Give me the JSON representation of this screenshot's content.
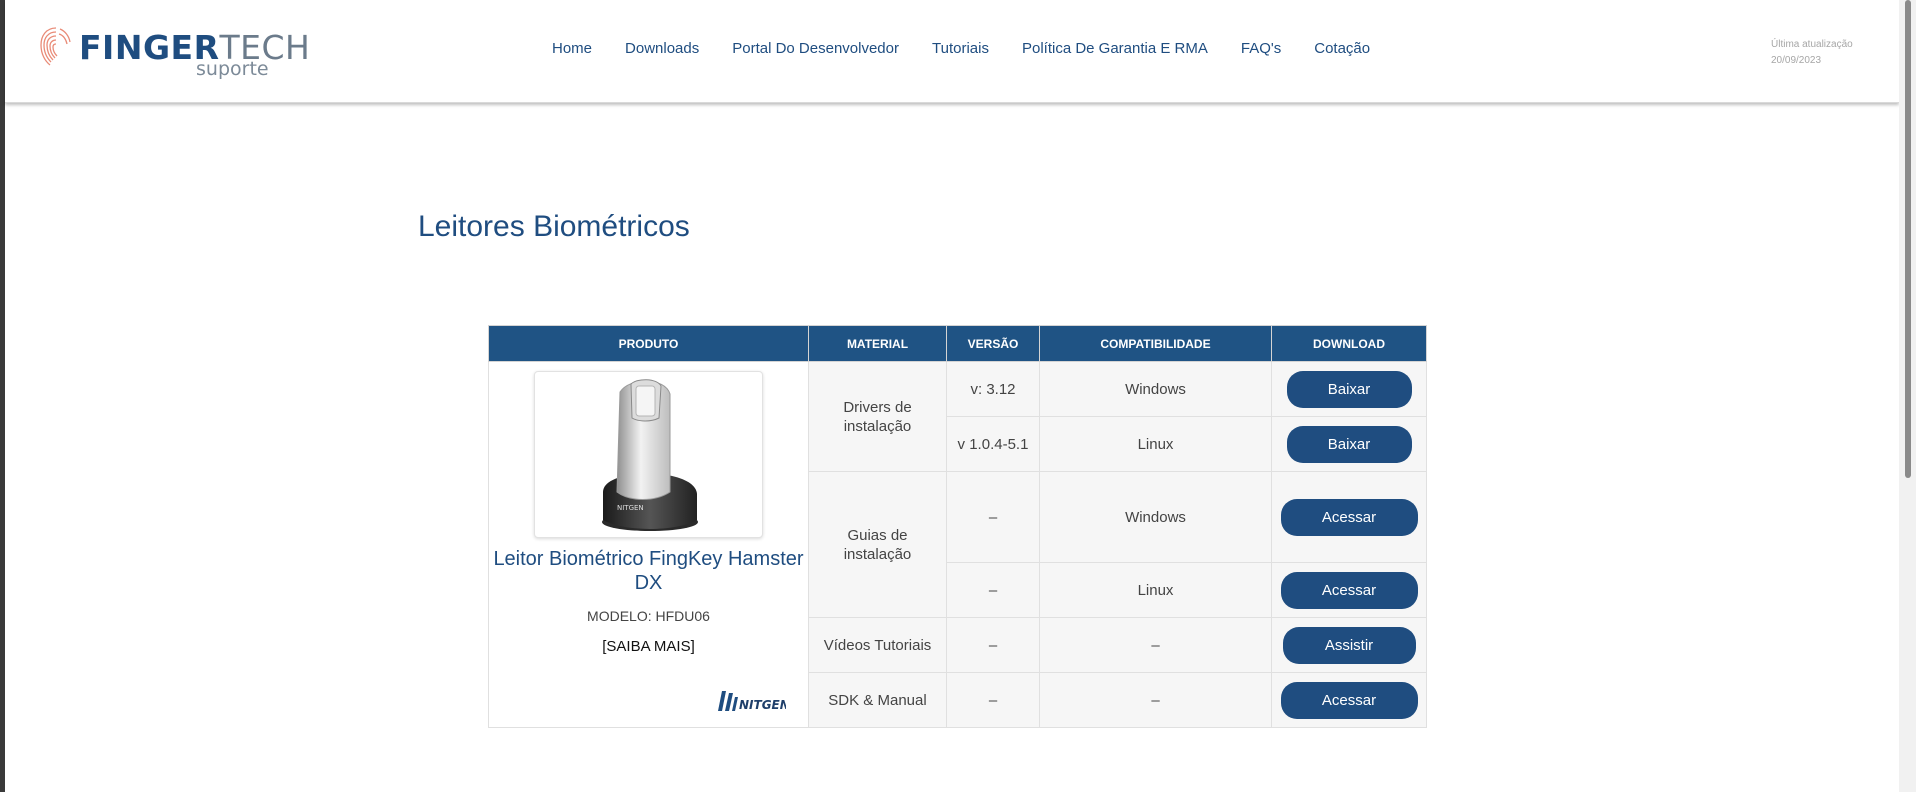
{
  "header": {
    "logo": {
      "brand_a": "FINGER",
      "brand_b": "TECH",
      "sub": "suporte"
    },
    "nav": [
      "Home",
      "Downloads",
      "Portal Do Desenvolvedor",
      "Tutoriais",
      "Política De Garantia E RMA",
      "FAQ's",
      "Cotação"
    ],
    "update_label": "Última atualização",
    "update_date": "20/09/2023"
  },
  "page_title": "Leitores Biométricos",
  "table": {
    "headers": [
      "PRODUTO",
      "MATERIAL",
      "VERSÃO",
      "COMPATIBILIDADE",
      "DOWNLOAD"
    ],
    "product": {
      "name": "Leitor Biométrico FingKey Hamster DX",
      "model": "MODELO: HFDU06",
      "more": "[SAIBA MAIS]",
      "brand_logo": "NITGEN"
    },
    "materials": [
      "Drivers de instalação",
      "Guias de instalação",
      "Vídeos Tutoriais",
      "SDK & Manual"
    ],
    "rows": [
      {
        "version": "v: 3.12",
        "compat": "Windows",
        "action": "Baixar"
      },
      {
        "version": "v 1.0.4-5.1",
        "compat": "Linux",
        "action": "Baixar"
      },
      {
        "version": "–",
        "compat": "Windows",
        "action": "Acessar"
      },
      {
        "version": "–",
        "compat": "Linux",
        "action": "Acessar"
      },
      {
        "version": "–",
        "compat": "–",
        "action": "Assistir"
      },
      {
        "version": "–",
        "compat": "–",
        "action": "Acessar"
      }
    ]
  },
  "colors": {
    "primary": "#1f4d80",
    "header_bg": "#1f5384"
  }
}
